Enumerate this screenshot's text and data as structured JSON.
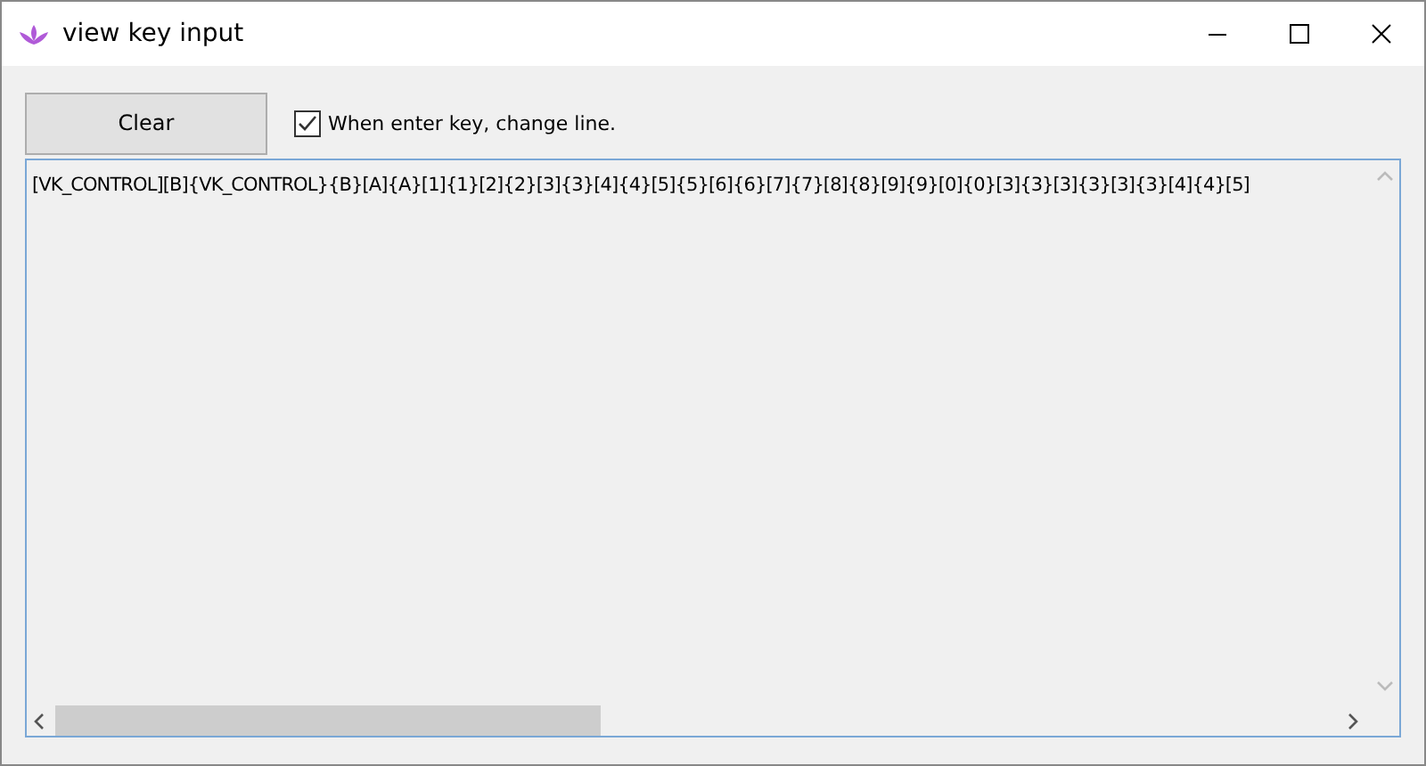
{
  "window": {
    "title": "view key input"
  },
  "clear_button": {
    "label": "Clear"
  },
  "option": {
    "label": "When enter key, change line.",
    "checked": true
  },
  "output": {
    "text": "[VK_CONTROL][B]{VK_CONTROL}{B}[A]{A}[1]{1}[2]{2}[3]{3}[4]{4}[5]{5}[6]{6}[7]{7}[8]{8}[9]{9}[0]{0}[3]{3}[3]{3}[3]{3}[4]{4}[5]"
  }
}
